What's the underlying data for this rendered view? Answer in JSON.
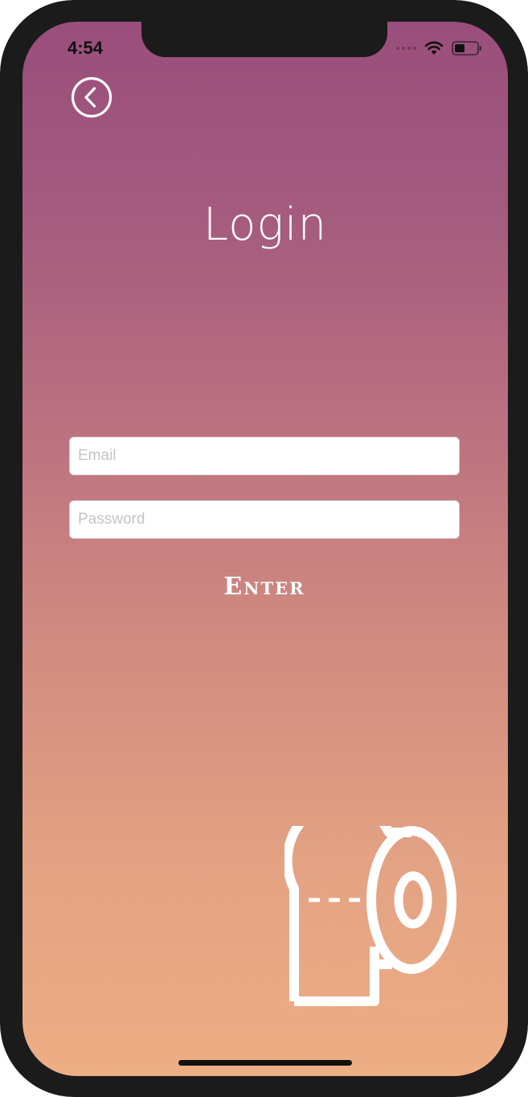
{
  "status_bar": {
    "time": "4:54",
    "icons": [
      "cellular-signal-icon",
      "wifi-icon",
      "battery-icon"
    ]
  },
  "header": {
    "back_icon": "chevron-left-circle-icon"
  },
  "login": {
    "title": "Login",
    "email_placeholder": "Email",
    "email_value": "",
    "password_placeholder": "Password",
    "password_value": "",
    "enter_label": "Enter"
  },
  "logo": {
    "icon": "toilet-paper-roll-icon"
  },
  "colors": {
    "gradient_top": "#9a4e7c",
    "gradient_bottom": "#edae84",
    "text": "#ffffff"
  }
}
